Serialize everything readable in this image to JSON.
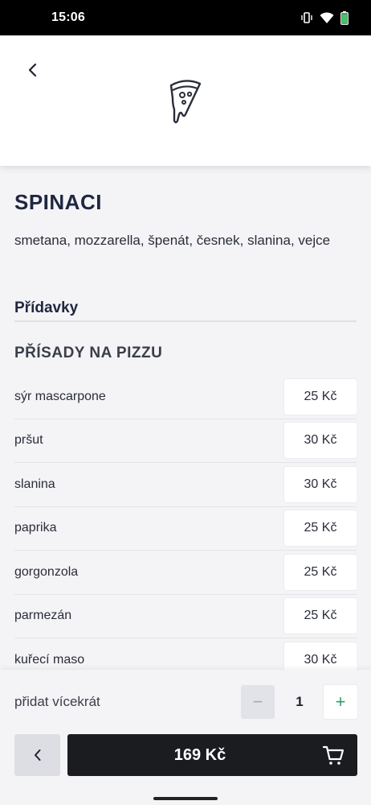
{
  "status_bar": {
    "time": "15:06",
    "icons": [
      "vibrate-icon",
      "wifi-icon",
      "battery-icon"
    ]
  },
  "header": {
    "back_icon": "chevron-left-icon",
    "logo_icon": "pizza-slice-icon"
  },
  "product": {
    "title": "SPINACI",
    "description": "smetana, mozzarella, špenát, česnek, slanina, vejce"
  },
  "extras_section": {
    "title": "Přídavky",
    "group_title": "PŘÍSADY NA PIZZU",
    "items": [
      {
        "name": "sýr mascarpone",
        "price": "25 Kč"
      },
      {
        "name": "pršut",
        "price": "30 Kč"
      },
      {
        "name": "slanina",
        "price": "30 Kč"
      },
      {
        "name": "paprika",
        "price": "25 Kč"
      },
      {
        "name": "gorgonzola",
        "price": "25 Kč"
      },
      {
        "name": "parmezán",
        "price": "25 Kč"
      },
      {
        "name": "kuřecí maso",
        "price": "30 Kč"
      }
    ]
  },
  "bottom": {
    "multi_label": "přidat vícekrát",
    "minus": "−",
    "quantity": "1",
    "plus": "+",
    "total": "169 Kč",
    "cart_icon": "shopping-cart-icon"
  },
  "colors": {
    "accent_green": "#2e9f6a",
    "dark_button": "#1b1c20",
    "title_navy": "#1f2640"
  }
}
